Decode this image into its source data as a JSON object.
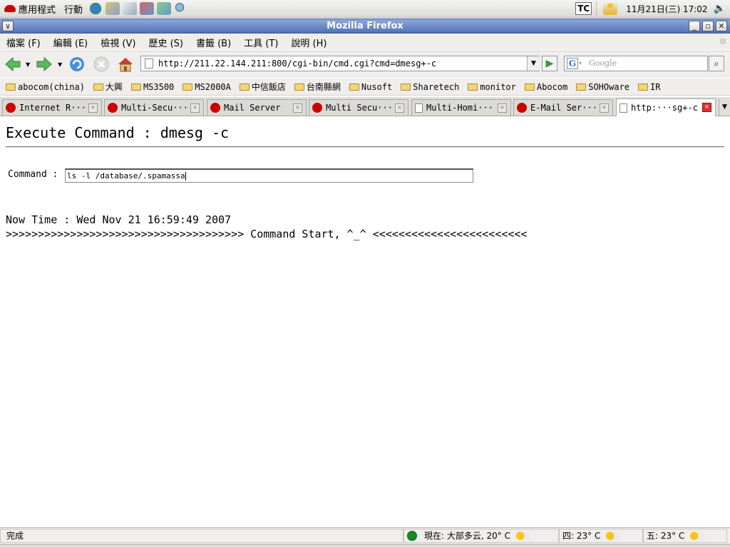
{
  "panel": {
    "apps_label": "應用程式",
    "actions_label": "行動",
    "input_method": "TC",
    "clock": "11月21日(三) 17:02"
  },
  "window": {
    "title": "Mozilla Firefox"
  },
  "menubar": [
    "檔案 (F)",
    "編輯 (E)",
    "檢視 (V)",
    "歷史 (S)",
    "書籤 (B)",
    "工具 (T)",
    "說明 (H)"
  ],
  "nav": {
    "url": "http://211.22.144.211:800/cgi-bin/cmd.cgi?cmd=dmesg+-c",
    "search_placeholder": "Google"
  },
  "bookmarks": [
    "abocom(china)",
    "大興",
    "MS3500",
    "MS2000A",
    "中信飯店",
    "台南縣網",
    "Nusoft",
    "Sharetech",
    "monitor",
    "Abocom",
    "SOHOware",
    "IR"
  ],
  "tabs": [
    "Internet R···",
    "Multi-Secu···",
    "Mail Server",
    "Multi Secu···",
    "Multi-Homi···",
    "E-Mail Ser···",
    "http:···sg+-c"
  ],
  "page": {
    "heading": "Execute Command : dmesg -c",
    "command_label": "Command :",
    "command_value": "ls -l /database/.spamassa",
    "now_time": "Now Time : Wed Nov 21 16:59:49 2007",
    "start_line": ">>>>>>>>>>>>>>>>>>>>>>>>>>>>>>>>>>>>> Command Start, ^_^ <<<<<<<<<<<<<<<<<<<<<<<<"
  },
  "status": {
    "text": "完成",
    "weather_now": "現在: 大部多云, 20° C",
    "weather_thu": "四: 23° C",
    "weather_fri": "五: 23° C"
  },
  "colors": {
    "titlebar": "#4f73b8",
    "chrome": "#efeeec"
  }
}
